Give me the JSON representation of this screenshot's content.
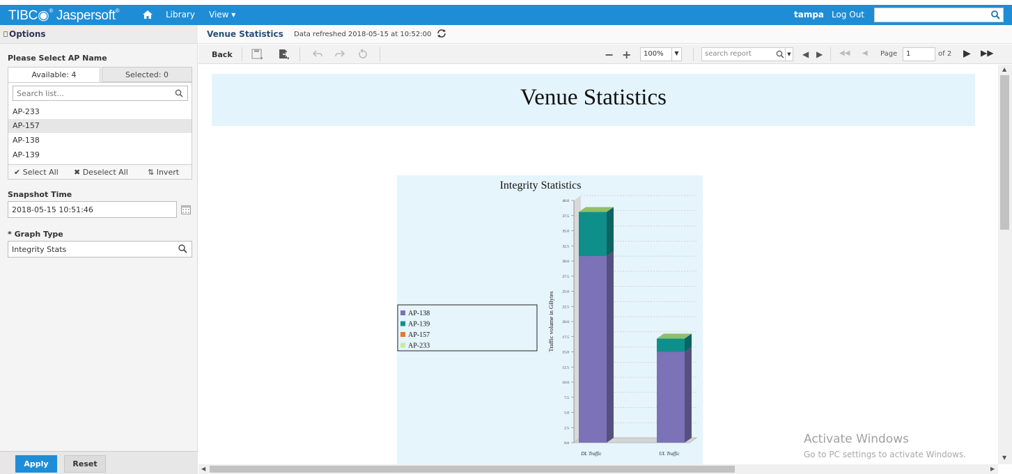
{
  "header": {
    "logo_text": "TIBC",
    "logo_suffix": "Jaspersoft",
    "home_icon": "home-icon",
    "nav_library": "Library",
    "nav_view": "View ▾",
    "user": "tampa",
    "logout": "Log Out",
    "search_value": ""
  },
  "options": {
    "title": "Options",
    "ap_section_label": "Please Select AP Name",
    "tab_available": "Available: 4",
    "tab_selected": "Selected: 0",
    "list_search_placeholder": "Search list...",
    "items": [
      "AP-233",
      "AP-157",
      "AP-138",
      "AP-139"
    ],
    "highlighted_item": "AP-157",
    "select_all": "✔ Select All",
    "deselect_all": "✖ Deselect All",
    "invert": "Invert",
    "snapshot_label": "Snapshot Time",
    "snapshot_value": "2018-05-15 10:51:46",
    "graph_type_label": "* Graph Type",
    "graph_type_value": "Integrity Stats",
    "apply": "Apply",
    "reset": "Reset"
  },
  "report": {
    "name": "Venue Statistics",
    "refreshed": "Data refreshed 2018-05-15 at 10:52:00",
    "back": "Back",
    "zoom": "100%",
    "search_placeholder": "search report",
    "page_label": "Page",
    "page_value": "1",
    "of_pages": "of 2",
    "banner_title": "Venue Statistics"
  },
  "colors": {
    "accent": "#1f8dd6",
    "banner_bg": "#e4f4fc",
    "ap138": "#7b72b8",
    "ap139": "#0f8f8a",
    "ap157": "#e8762d",
    "ap233": "#c7ec9b"
  },
  "chart_data": {
    "type": "bar",
    "stacked": true,
    "three_d": true,
    "title": "Integrity Statistics",
    "xlabel": "",
    "ylabel": "Traffic volume in GBytes",
    "categories": [
      "DL Traffic",
      "UL Traffic"
    ],
    "series": [
      {
        "name": "AP-138",
        "values": [
          30.8,
          15.0
        ],
        "color": "#7b72b8"
      },
      {
        "name": "AP-139",
        "values": [
          7.3,
          2.2
        ],
        "color": "#0f8f8a"
      },
      {
        "name": "AP-157",
        "values": [
          0,
          0
        ],
        "color": "#e8762d"
      },
      {
        "name": "AP-233",
        "values": [
          0,
          0
        ],
        "color": "#c7ec9b"
      }
    ],
    "ylim": [
      0,
      40
    ],
    "yticks": [
      "0.0",
      "2.5",
      "5.0",
      "7.5",
      "10.0",
      "12.5",
      "15.0",
      "17.5",
      "20.0",
      "22.5",
      "25.0",
      "27.5",
      "30.0",
      "32.5",
      "35.0",
      "37.5",
      "40.0"
    ],
    "grid": true,
    "legend_position": "left"
  },
  "watermark": {
    "line1": "Activate Windows",
    "line2": "Go to PC settings to activate Windows."
  }
}
